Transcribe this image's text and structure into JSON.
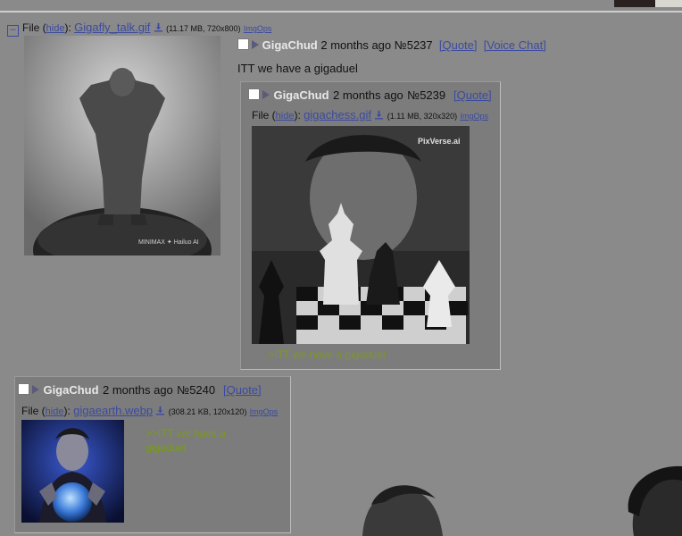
{
  "op": {
    "collapse_label": "[–]",
    "file_prefix": "File (",
    "hide_label": "hide",
    "file_suffix": "):",
    "filename": "Gigafly_talk.gif",
    "fileinfo": "(11.17 MB, 720x800)",
    "imgops": "ImgOps",
    "name": "GigaChud",
    "time": "2 months ago",
    "post_no": "№5237",
    "quote_label": "[Quote]",
    "voice_chat_label": "[Voice Chat]",
    "text": "ITT we have a gigaduel",
    "image_watermark": "MINIMAX  ✦ Hailuo AI"
  },
  "reply1": {
    "name": "GigaChud",
    "time": "2 months ago",
    "post_no": "№5239",
    "quote_label": "[Quote]",
    "file_prefix": "File (",
    "hide_label": "hide",
    "file_suffix": "):",
    "filename": "gigachess.gif",
    "fileinfo": "(1.11 MB, 320x320)",
    "imgops": "ImgOps",
    "image_watermark": "PixVerse.ai",
    "text": ">ITT we have a gigaduel"
  },
  "reply2": {
    "name": "GigaChud",
    "time": "2 months ago",
    "post_no": "№5240",
    "quote_label": "[Quote]",
    "file_prefix": "File (",
    "hide_label": "hide",
    "file_suffix": "):",
    "filename": "gigaearth.webp",
    "fileinfo": "(308.21 KB, 120x120)",
    "imgops": "ImgOps",
    "text": ">>ITT we have a gigaduel"
  }
}
